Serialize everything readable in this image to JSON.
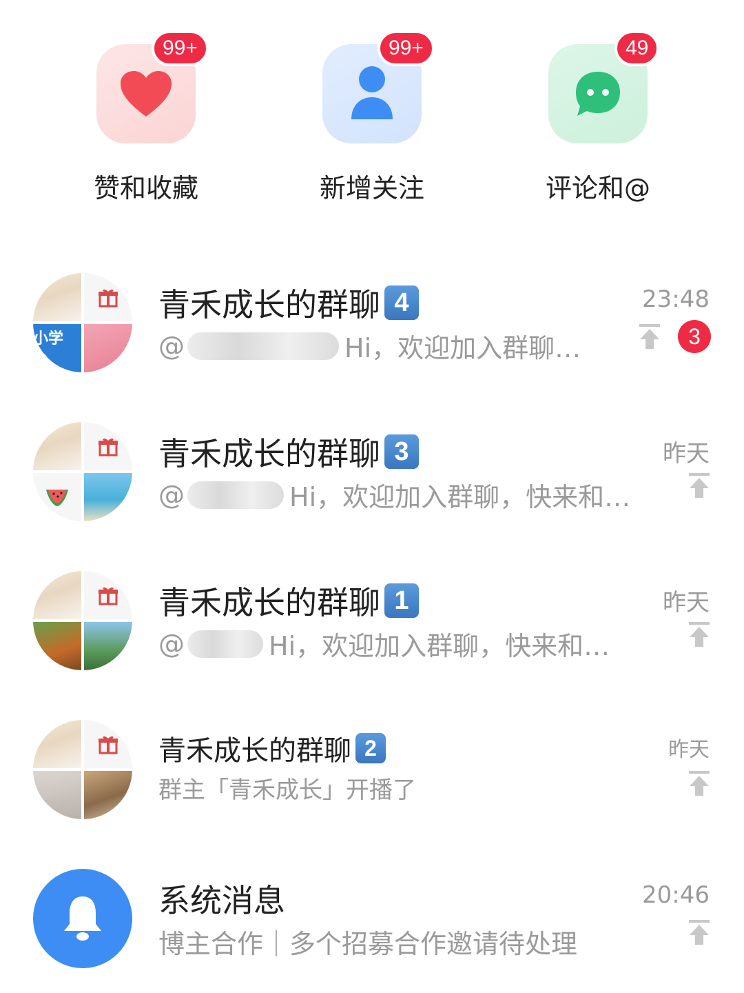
{
  "shortcuts": [
    {
      "label": "赞和收藏",
      "badge": "99+",
      "icon": "heart-icon",
      "color": "#f24b55"
    },
    {
      "label": "新增关注",
      "badge": "99+",
      "icon": "person-icon",
      "color": "#3d8df5"
    },
    {
      "label": "评论和@",
      "badge": "49",
      "icon": "chat-bubble-icon",
      "color": "#2ec07a"
    }
  ],
  "chats": [
    {
      "title": "青禾成长的群聊",
      "number": "4",
      "preview_prefix": "@",
      "preview": "Hi，欢迎加入群聊…",
      "time": "23:48",
      "unread": "3",
      "avatar_tile_text": "小学 尖"
    },
    {
      "title": "青禾成长的群聊",
      "number": "3",
      "preview_prefix": "@",
      "preview": "Hi，欢迎加入群聊，快来和…",
      "time": "昨天"
    },
    {
      "title": "青禾成长的群聊",
      "number": "1",
      "preview_prefix": "@",
      "preview": "Hi，欢迎加入群聊，快来和…",
      "time": "昨天"
    },
    {
      "title": "青禾成长的群聊",
      "number": "2",
      "preview": "群主「青禾成长」开播了",
      "time": "昨天"
    },
    {
      "title": "系统消息",
      "preview": "博主合作｜多个招募合作邀请待处理",
      "time": "20:46",
      "icon": "bell-icon"
    }
  ],
  "colors": {
    "badge_red": "#ef2a45",
    "number_badge_blue": "#3a77bf",
    "system_blue": "#3d8df5",
    "muted_text": "#9a9a9a"
  }
}
